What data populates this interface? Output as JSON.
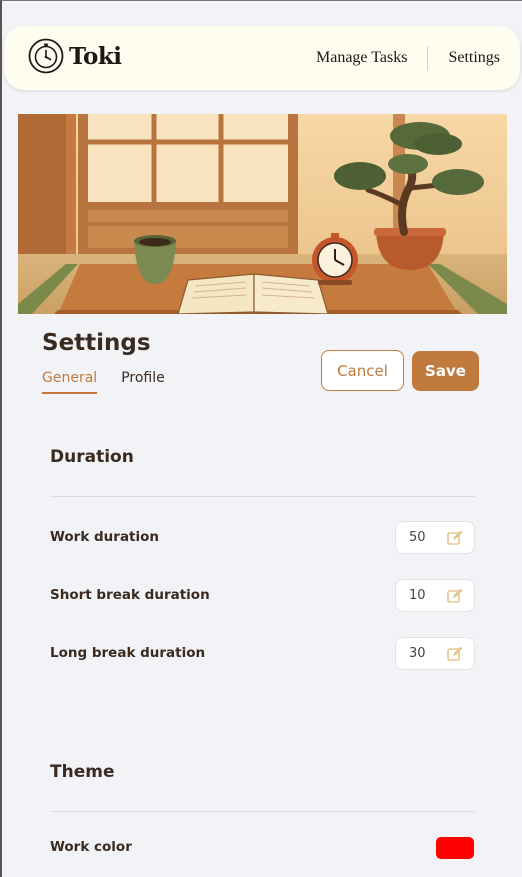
{
  "navbar": {
    "brand": "Toki",
    "links": [
      "Manage Tasks",
      "Settings"
    ]
  },
  "hero": {
    "icon": "japanese-room-illustration"
  },
  "settings": {
    "title": "Settings",
    "tabs": [
      "General",
      "Profile"
    ],
    "active_tab": "General",
    "cancel_label": "Cancel",
    "save_label": "Save"
  },
  "duration": {
    "title": "Duration",
    "rows": [
      {
        "label": "Work duration",
        "value": "50"
      },
      {
        "label": "Short break duration",
        "value": "10"
      },
      {
        "label": "Long break duration",
        "value": "30"
      }
    ]
  },
  "theme": {
    "title": "Theme",
    "work_color_label": "Work color",
    "work_color": "#ff0000"
  },
  "colors": {
    "accent": "#c07a3e",
    "background": "#f2f3f7",
    "navbar_bg": "#fffcf0",
    "text": "#3a2a20"
  }
}
